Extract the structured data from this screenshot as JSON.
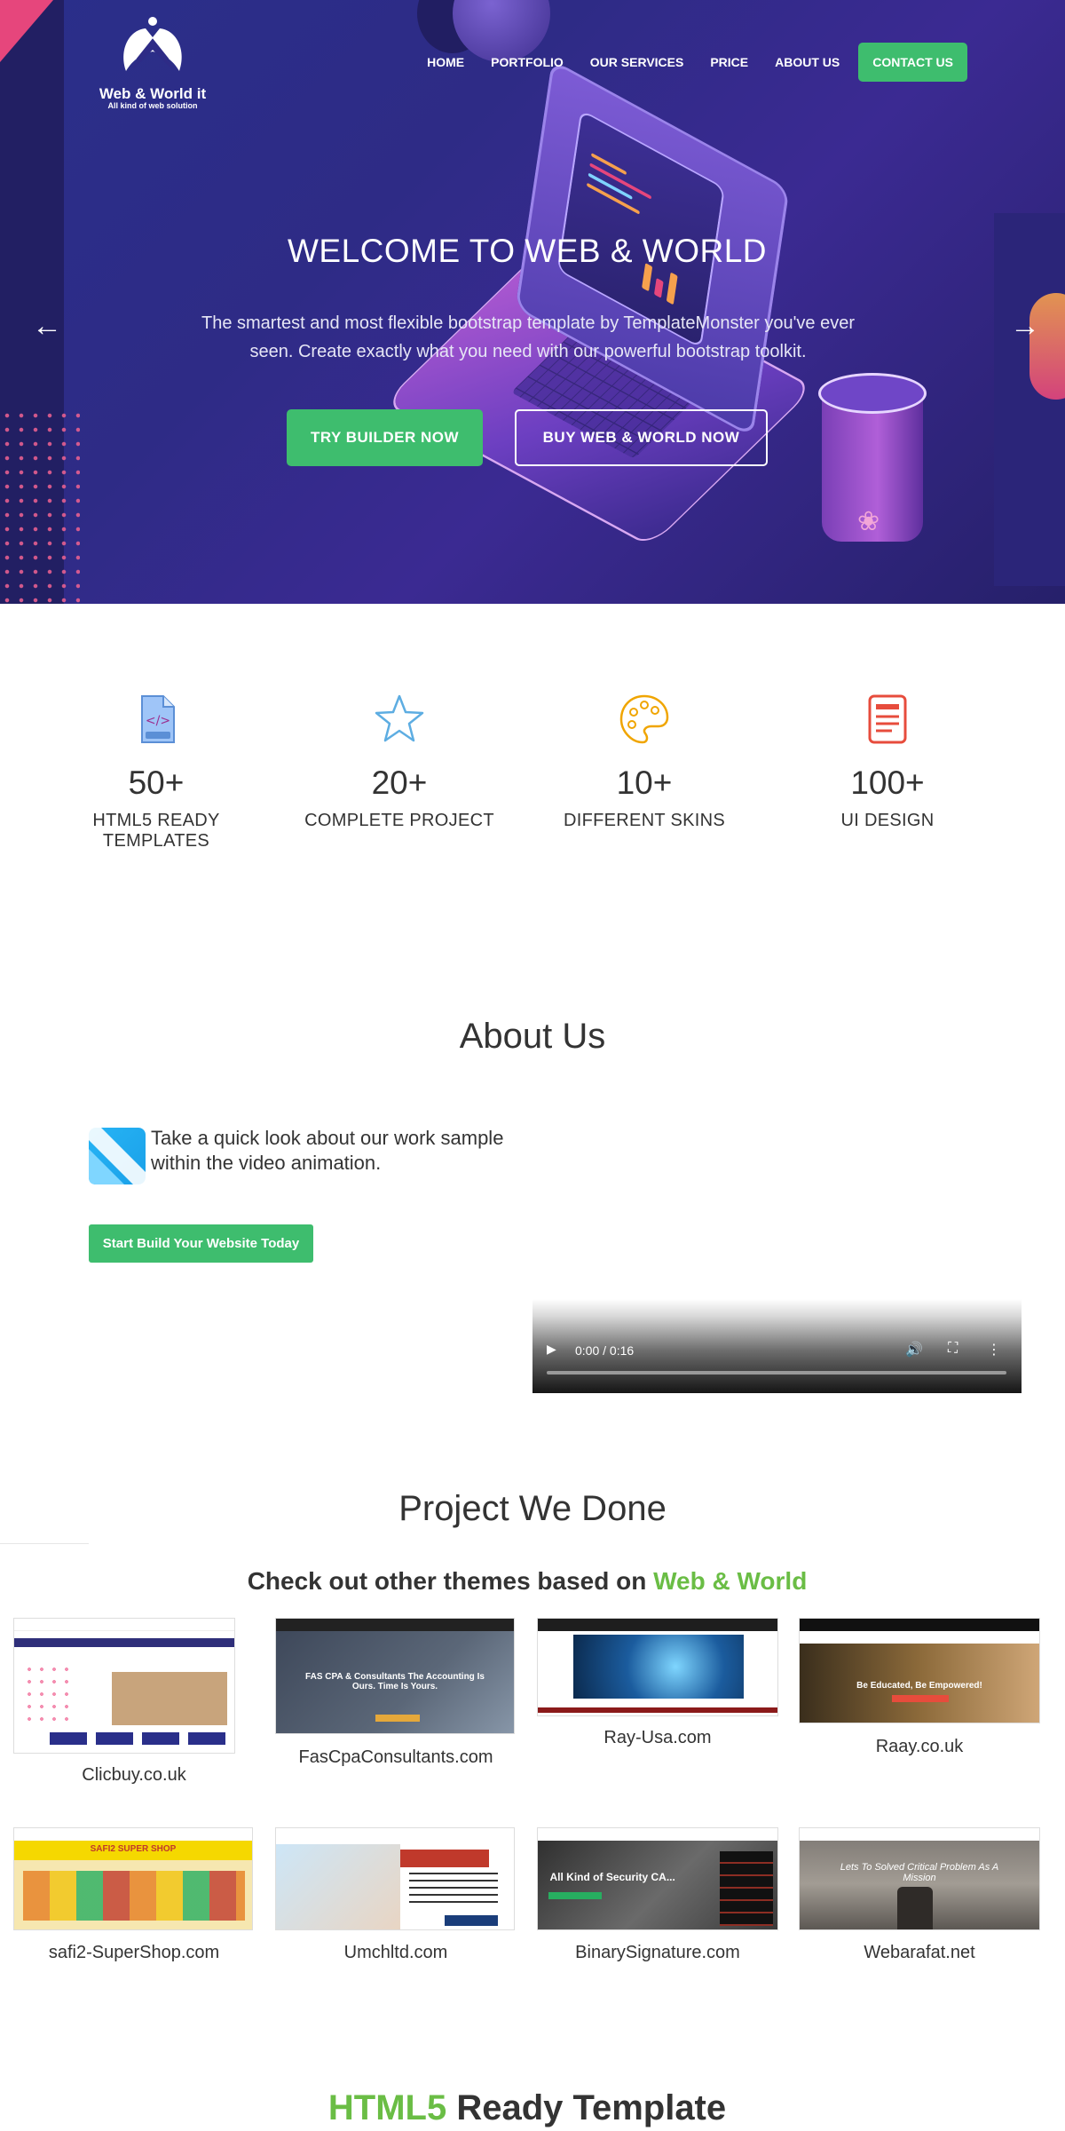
{
  "brand": {
    "name": "Web & World it",
    "tagline": "All kind of web solution"
  },
  "nav": {
    "items": [
      "HOME",
      "PORTFOLIO",
      "OUR SERVICES",
      "PRICE",
      "ABOUT US"
    ],
    "contact": "CONTACT US"
  },
  "hero": {
    "title": "WELCOME TO WEB & WORLD",
    "subtitle": "The smartest and most flexible bootstrap template by TemplateMonster you've ever seen. Create exactly what you need with our powerful bootstrap toolkit.",
    "primary_button": "TRY BUILDER NOW",
    "secondary_button": "BUY WEB & WORLD NOW",
    "prev_icon": "arrow-left-icon",
    "next_icon": "arrow-right-icon"
  },
  "stats": [
    {
      "icon": "html-file-icon",
      "value": "50+",
      "label": "HTML5 READY TEMPLATES",
      "color": "#9b59b6"
    },
    {
      "icon": "star-icon",
      "value": "20+",
      "label": "COMPLETE PROJECT",
      "color": "#5dade2"
    },
    {
      "icon": "palette-icon",
      "value": "10+",
      "label": "DIFFERENT SKINS",
      "color": "#f0a500"
    },
    {
      "icon": "document-icon",
      "value": "100+",
      "label": "UI DESIGN",
      "color": "#e74c3c"
    }
  ],
  "about": {
    "title": "About Us",
    "text": "Take a quick look about our work sample within the video animation.",
    "button": "Start Build Your Website Today",
    "video_time": "0:00 / 0:16"
  },
  "projects": {
    "title": "Project We Done",
    "subtitle_prefix": "Check out other themes based on ",
    "subtitle_highlight": "Web & World",
    "items": [
      {
        "label": "Clicbuy.co.uk"
      },
      {
        "label": "FasCpaConsultants.com",
        "caption": "FAS CPA & Consultants The Accounting Is Ours. Time Is Yours."
      },
      {
        "label": "Ray-Usa.com"
      },
      {
        "label": "Raay.co.uk",
        "caption": "Be Educated, Be Empowered!"
      },
      {
        "label": "safi2-SuperShop.com",
        "caption": "SAFI2 SUPER SHOP"
      },
      {
        "label": "Umchltd.com"
      },
      {
        "label": "BinarySignature.com",
        "caption": "All Kind of Security CA..."
      },
      {
        "label": "Webarafat.net",
        "caption": "Lets To Solved Critical Problem As A Mission"
      }
    ]
  },
  "templates": {
    "title_highlight": "HTML5",
    "title_rest": " Ready Template"
  },
  "colors": {
    "accent": "#3ebd6e",
    "highlight": "#6abd45",
    "hero_bg": "#2e2b86"
  }
}
